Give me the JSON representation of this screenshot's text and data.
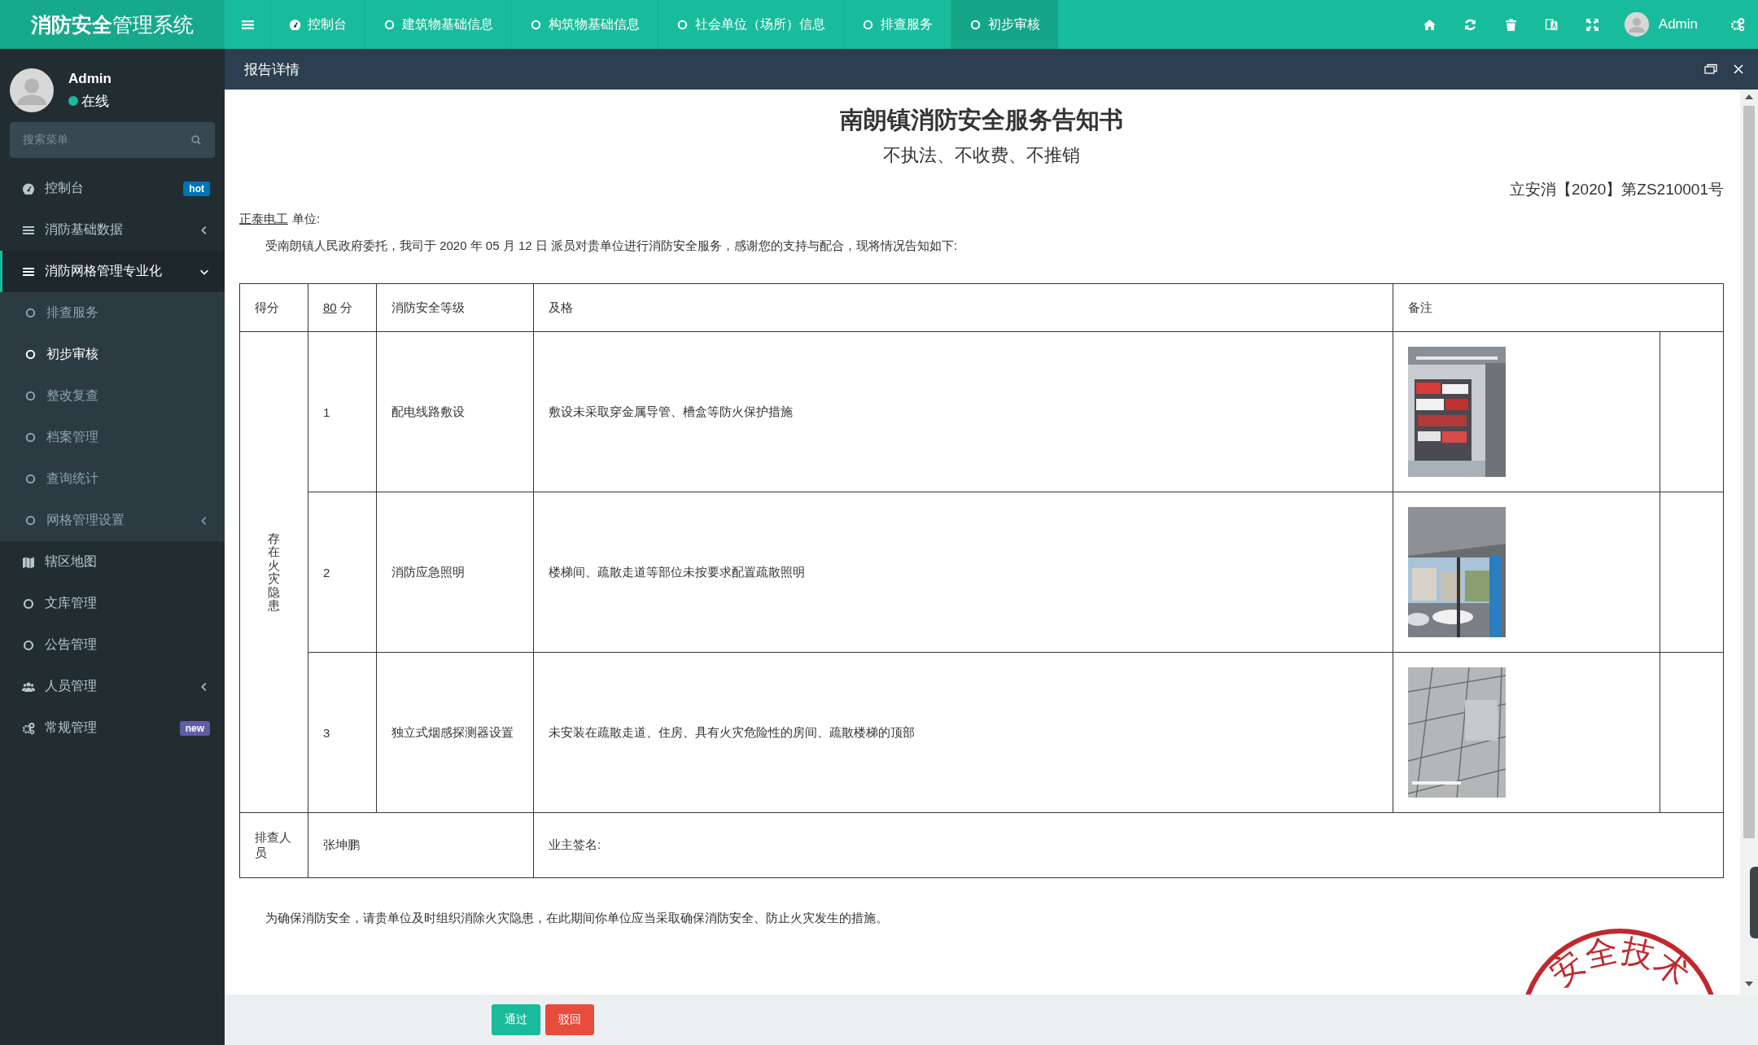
{
  "logo": "**消防安全**管理系统",
  "topnav": [
    {
      "label": "控制台",
      "selected": false
    },
    {
      "label": "建筑物基础信息",
      "selected": false
    },
    {
      "label": "构筑物基础信息",
      "selected": false
    },
    {
      "label": "社会单位（场所）信息",
      "selected": false
    },
    {
      "label": "排查服务",
      "selected": false
    },
    {
      "label": "初步审核",
      "selected": true
    }
  ],
  "top_user": "Admin",
  "sidebar": {
    "user": "Admin",
    "status": "在线",
    "search": {
      "placeholder": "搜索菜单"
    },
    "items": [
      {
        "label": "控制台",
        "kind": "link",
        "selected": false,
        "badge": {
          "text": "hot",
          "color": "#0073b7"
        }
      },
      {
        "label": "消防基础数据",
        "kind": "group",
        "selected": false,
        "expanded": false
      },
      {
        "label": "消防网格管理专业化",
        "kind": "group",
        "selected": true,
        "expanded": true,
        "children": [
          {
            "label": "排查服务",
            "selected": false,
            "kind": "link"
          },
          {
            "label": "初步审核",
            "selected": true,
            "kind": "link"
          },
          {
            "label": "整改复查",
            "selected": false,
            "kind": "link"
          },
          {
            "label": "档案管理",
            "selected": false,
            "kind": "link"
          },
          {
            "label": "查询统计",
            "selected": false,
            "kind": "link"
          },
          {
            "label": "网格管理设置",
            "selected": false,
            "kind": "group",
            "expanded": false
          }
        ]
      },
      {
        "label": "辖区地图",
        "kind": "link",
        "selected": false
      },
      {
        "label": "文库管理",
        "kind": "link",
        "selected": false
      },
      {
        "label": "公告管理",
        "kind": "link",
        "selected": false
      },
      {
        "label": "人员管理",
        "kind": "group",
        "selected": false,
        "expanded": false
      },
      {
        "label": "常规管理",
        "kind": "link",
        "selected": false,
        "badge": {
          "text": "new",
          "color": "#605ca8"
        }
      }
    ]
  },
  "panel": {
    "title": "报告详情"
  },
  "document": {
    "title": "南朗镇消防安全服务告知书",
    "subtitle": "不执法、不收费、不推销",
    "number": "立安消【2020】第ZS210001号",
    "unit_name": "正泰电工",
    "unit_label": "单位:",
    "intro": "受南朗镇人民政府委托，我司于 2020 年 05 月 12 日 派员对贵单位进行消防安全服务，感谢您的支持与配合，现将情况告知如下:",
    "table": {
      "score_label": "得分",
      "score_value": "80",
      "score_unit": "分",
      "level_label": "消防安全等级",
      "level_value": "及格",
      "remark_label": "备注",
      "hazard_label": "存在火灾隐患",
      "rows": [
        {
          "no": "1",
          "item": "配电线路敷设",
          "description": "敷设未采取穿金属导管、槽盒等防火保护措施"
        },
        {
          "no": "2",
          "item": "消防应急照明",
          "description": "楼梯间、疏散走道等部位未按要求配置疏散照明"
        },
        {
          "no": "3",
          "item": "独立式烟感探测器设置",
          "description": "未安装在疏散走道、住房、具有火灾危险性的房间、疏散楼梯的顶部"
        }
      ],
      "inspector_label": "排查人员",
      "inspector": "张坤鹏",
      "signature_label": "业主签名:"
    },
    "closing": "为确保消防安全，请贵单位及时组织消除火灾隐患，在此期间你单位应当采取确保消防安全、防止火灾发生的措施。",
    "stamp": "安全技术"
  },
  "buttons": [
    {
      "label": "通过",
      "kind": "primary"
    },
    {
      "label": "驳回",
      "kind": "danger"
    }
  ]
}
